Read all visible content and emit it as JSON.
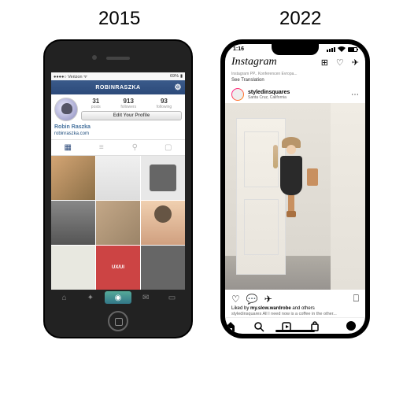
{
  "years": {
    "left": "2015",
    "right": "2022"
  },
  "phone2015": {
    "status": {
      "carrier": "Verizon",
      "signal": "●●●●○",
      "time": "",
      "battery": "69%"
    },
    "header": {
      "title": "ROBINRASZKA"
    },
    "stats": {
      "posts": {
        "n": "31",
        "l": "posts"
      },
      "followers": {
        "n": "913",
        "l": "followers"
      },
      "following": {
        "n": "93",
        "l": "following"
      }
    },
    "edit": "Edit Your Profile",
    "name": "Robin Raszka",
    "link": "robinraszka.com",
    "grid_text": "UX/UI"
  },
  "phone2022": {
    "status": {
      "time": "1:16"
    },
    "logo": "Instagram",
    "translation_hint": "Instagram PP.. Konferencen Evropa...",
    "see_translation": "See Translation",
    "post": {
      "user": "styledinsquares",
      "location": "Santa Cruz, California",
      "liked_prefix": "Liked by ",
      "liked_user": "my.slow.wardrobe",
      "liked_suffix": " and others",
      "caption": "styledinsquares All I need now is a coffee in the other..."
    }
  }
}
